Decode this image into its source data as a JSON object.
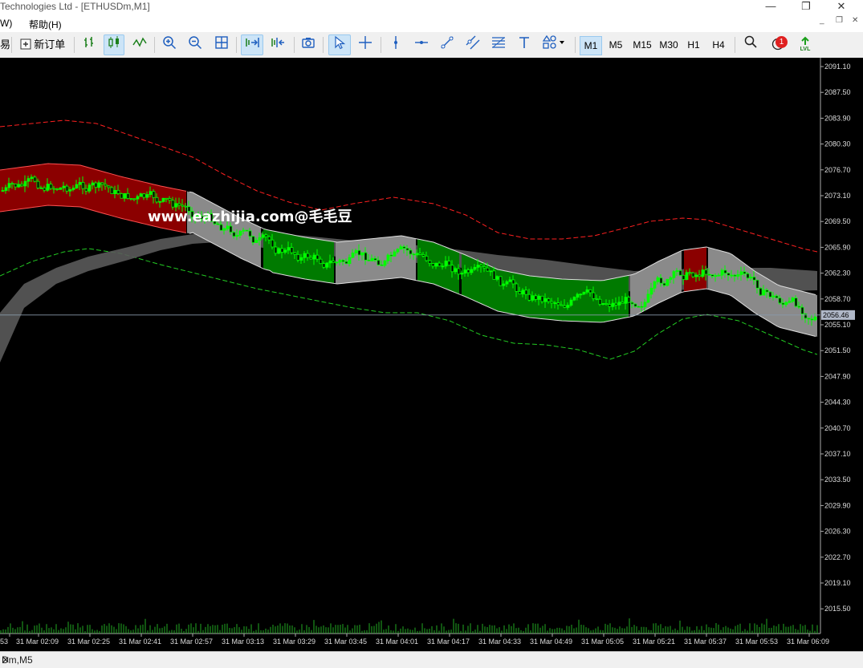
{
  "window": {
    "title": "Technologies Ltd - [ETHUSDm,M1]",
    "minimize": "—",
    "restore": "❐",
    "close": "✕",
    "sub_minimize": "_",
    "sub_restore": "❐",
    "sub_close": "✕"
  },
  "menu": {
    "items": [
      "W)",
      "帮助(H)"
    ]
  },
  "toolbar": {
    "partial_left": "易",
    "new_order": "新订单",
    "timeframes": [
      "M1",
      "M5",
      "M15",
      "M30",
      "H1",
      "H4"
    ],
    "active_timeframe": "M1",
    "notification_count": "1",
    "lvl_label": "LVL",
    "lvl_fraction": 0.2
  },
  "chart": {
    "symbol_window": "Dm,M5",
    "watermark": "www.eazhijia.com@毛毛豆",
    "current_price": "2056.46",
    "price_labels": [
      "2091.10",
      "2087.50",
      "2083.90",
      "2080.30",
      "2076.70",
      "2073.10",
      "2069.50",
      "2065.90",
      "2062.30",
      "2058.70",
      "2055.10",
      "2051.50",
      "2047.90",
      "2044.30",
      "2040.70",
      "2037.10",
      "2033.50",
      "2029.90",
      "2026.30",
      "2022.70",
      "2019.10",
      "2015.50"
    ],
    "time_labels": [
      "53",
      "31 Mar 02:09",
      "31 Mar 02:25",
      "31 Mar 02:41",
      "31 Mar 02:57",
      "31 Mar 03:13",
      "31 Mar 03:29",
      "31 Mar 03:45",
      "31 Mar 04:01",
      "31 Mar 04:17",
      "31 Mar 04:33",
      "31 Mar 04:49",
      "31 Mar 05:05",
      "31 Mar 05:21",
      "31 Mar 05:37",
      "31 Mar 05:53",
      "31 Mar 06:09"
    ],
    "colors": {
      "background": "#000000",
      "bull": "#00ff00",
      "band_red": "#8b0000",
      "band_green": "#007a00",
      "band_gray": "#8a8a8a",
      "outer_upper": "#ff2020",
      "outer_lower": "#22cc22",
      "slow_band": "#5a5a5a"
    }
  }
}
